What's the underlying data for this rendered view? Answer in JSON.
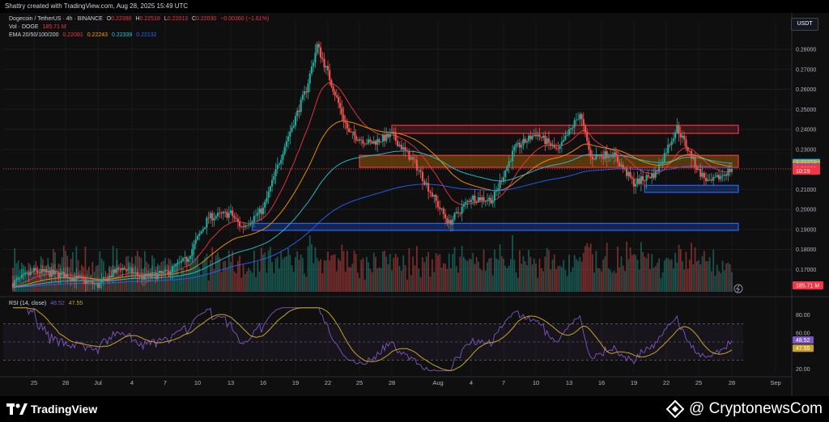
{
  "header": {
    "credit": "Shattry created with TradingView.com, Aug 28, 2025 15:49 UTC"
  },
  "legend": {
    "symbol": "Dogecoin / TetherUS · 4h · BINANCE",
    "ohlc": {
      "o_label": "O",
      "o": "0.22390",
      "h_label": "H",
      "h": "0.22518",
      "l_label": "L",
      "l": "0.22013",
      "c_label": "C",
      "c": "0.22030",
      "change": "−0.00360 (−1.61%)"
    },
    "vol_label": "Vol · DOGE",
    "vol_value": "185.71 M",
    "ema_label": "EMA 20/50/100/200",
    "ema_values": [
      "0.22081",
      "0.22243",
      "0.22339",
      "0.22132"
    ],
    "rsi_label": "RSI (14, close)",
    "rsi_values": [
      "48.52",
      "47.55"
    ]
  },
  "price_axis": {
    "currency": "USDT",
    "ticks": [
      "0.28000",
      "0.27000",
      "0.26000",
      "0.25000",
      "0.24000",
      "0.23000",
      "0.22000",
      "0.21000",
      "0.20000",
      "0.19000",
      "0.18000",
      "0.17000"
    ],
    "tags": [
      {
        "text": "0.22339",
        "color": "#26c6da",
        "value": 0.22339
      },
      {
        "text": "0.22243",
        "color": "#ff9800",
        "value": 0.22243
      },
      {
        "text": "0.22132",
        "color": "#2962ff",
        "value": 0.22132
      },
      {
        "text": "0.22081",
        "color": "#f23645",
        "value": 0.22081
      },
      {
        "text": "0.22030",
        "color": "#f23645",
        "value": 0.2203
      },
      {
        "text": "10:19",
        "color": "#f23645",
        "value": 0.2192
      }
    ],
    "volume_tag": "185.71 M"
  },
  "rsi_axis": {
    "ticks": [
      "80.00",
      "60.00",
      "20.00"
    ],
    "tag_values": [
      {
        "text": "48.52",
        "color": "#7e57c2",
        "value": 48.52
      },
      {
        "text": "47.55",
        "color": "#c9a227",
        "value": 47.55
      }
    ],
    "upper_band": 70,
    "lower_band": 30,
    "mid": 50
  },
  "time_axis": {
    "ticks": [
      "25",
      "28",
      "Jul",
      "4",
      "7",
      "10",
      "13",
      "16",
      "19",
      "22",
      "25",
      "28",
      "Aug",
      "4",
      "7",
      "10",
      "13",
      "16",
      "19",
      "22",
      "25",
      "28",
      "Sep"
    ]
  },
  "colors": {
    "up": "#26a69a",
    "down": "#ef5350",
    "ema20": "#f23645",
    "ema50": "#ff9800",
    "ema100": "#26c6da",
    "ema200": "#2962ff",
    "rsi": "#7e57c2",
    "rsi_ma": "#c9a227"
  },
  "chart_data": {
    "type": "candlestick",
    "pair": "DOGE/USDT",
    "timeframe": "4h",
    "ylim": [
      0.165,
      0.29
    ],
    "x_range": [
      "Jun 23",
      "Sep 1"
    ],
    "price_path": [
      {
        "date": "Jun 23",
        "price": 0.163
      },
      {
        "date": "Jun 25",
        "price": 0.169
      },
      {
        "date": "Jun 28",
        "price": 0.167
      },
      {
        "date": "Jul 1",
        "price": 0.162
      },
      {
        "date": "Jul 3",
        "price": 0.171
      },
      {
        "date": "Jul 5",
        "price": 0.166
      },
      {
        "date": "Jul 7",
        "price": 0.168
      },
      {
        "date": "Jul 9",
        "price": 0.175
      },
      {
        "date": "Jul 11",
        "price": 0.196
      },
      {
        "date": "Jul 13",
        "price": 0.198
      },
      {
        "date": "Jul 14",
        "price": 0.191
      },
      {
        "date": "Jul 16",
        "price": 0.2
      },
      {
        "date": "Jul 18",
        "price": 0.232
      },
      {
        "date": "Jul 20",
        "price": 0.26
      },
      {
        "date": "Jul 21",
        "price": 0.282
      },
      {
        "date": "Jul 22",
        "price": 0.268
      },
      {
        "date": "Jul 24",
        "price": 0.238
      },
      {
        "date": "Jul 26",
        "price": 0.233
      },
      {
        "date": "Jul 28",
        "price": 0.237
      },
      {
        "date": "Jul 30",
        "price": 0.223
      },
      {
        "date": "Aug 1",
        "price": 0.202
      },
      {
        "date": "Aug 2",
        "price": 0.193
      },
      {
        "date": "Aug 4",
        "price": 0.206
      },
      {
        "date": "Aug 6",
        "price": 0.205
      },
      {
        "date": "Aug 8",
        "price": 0.23
      },
      {
        "date": "Aug 10",
        "price": 0.238
      },
      {
        "date": "Aug 12",
        "price": 0.229
      },
      {
        "date": "Aug 14",
        "price": 0.248
      },
      {
        "date": "Aug 15",
        "price": 0.226
      },
      {
        "date": "Aug 17",
        "price": 0.228
      },
      {
        "date": "Aug 19",
        "price": 0.213
      },
      {
        "date": "Aug 21",
        "price": 0.218
      },
      {
        "date": "Aug 23",
        "price": 0.241
      },
      {
        "date": "Aug 25",
        "price": 0.219
      },
      {
        "date": "Aug 26",
        "price": 0.213
      },
      {
        "date": "Aug 28",
        "price": 0.2203
      }
    ],
    "boxes": [
      {
        "color": "#f23645",
        "fill": "rgba(242,54,69,0.18)",
        "y_top": 0.242,
        "y_bottom": 0.238,
        "x_start": "Jul 28",
        "x_end": "Aug 28"
      },
      {
        "color": "#f23645",
        "fill": "rgba(255,152,0,0.30)",
        "y_top": 0.227,
        "y_bottom": 0.221,
        "x_start": "Jul 25",
        "x_end": "Aug 28"
      },
      {
        "color": "#2962ff",
        "fill": "rgba(41,98,255,0.25)",
        "y_top": 0.212,
        "y_bottom": 0.2085,
        "x_start": "Aug 20",
        "x_end": "Aug 28"
      },
      {
        "color": "#2962ff",
        "fill": "rgba(41,98,255,0.25)",
        "y_top": 0.193,
        "y_bottom": 0.1895,
        "x_start": "Jul 15",
        "x_end": "Aug 28"
      }
    ]
  }
}
